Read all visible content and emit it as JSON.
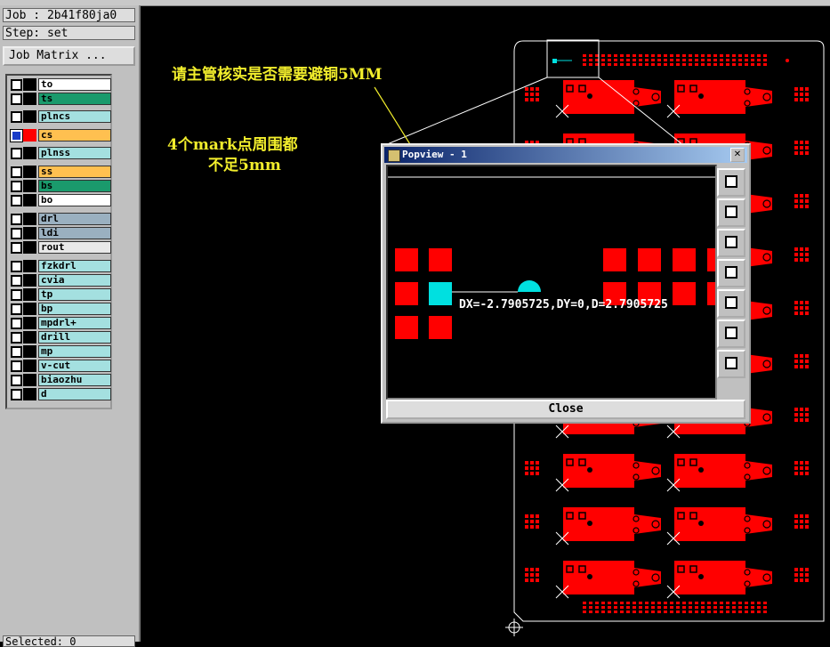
{
  "job": "Job : 2b41f80ja0",
  "step": "Step: set",
  "job_matrix": "Job Matrix ...",
  "layers": [
    {
      "name": "to",
      "color": "#ffffff",
      "swatch": "#000000",
      "checked": false
    },
    {
      "name": "ts",
      "color": "#1a9a6c",
      "swatch": "#000000",
      "checked": false
    },
    {
      "name": "plncs",
      "color": "#a4e0e0",
      "swatch": "#000000",
      "checked": false
    },
    {
      "name": "cs",
      "color": "#ffc050",
      "swatch": "#ff0000",
      "checked": true
    },
    {
      "name": "plnss",
      "color": "#a4e0e0",
      "swatch": "#000000",
      "checked": false
    },
    {
      "name": "ss",
      "color": "#ffc050",
      "swatch": "#000000",
      "checked": false
    },
    {
      "name": "bs",
      "color": "#1a9a6c",
      "swatch": "#000000",
      "checked": false
    },
    {
      "name": "bo",
      "color": "#ffffff",
      "swatch": "#000000",
      "checked": false
    },
    {
      "name": "drl",
      "color": "#9ab0c0",
      "swatch": "#000000",
      "checked": false
    },
    {
      "name": "ldi",
      "color": "#9ab0c0",
      "swatch": "#000000",
      "checked": false
    },
    {
      "name": "rout",
      "color": "#e8e8e8",
      "swatch": "#000000",
      "checked": false
    },
    {
      "name": "fzkdrl",
      "color": "#a4e0e0",
      "swatch": "#000000",
      "checked": false
    },
    {
      "name": "cvia",
      "color": "#a4e0e0",
      "swatch": "#000000",
      "checked": false
    },
    {
      "name": "tp",
      "color": "#a4e0e0",
      "swatch": "#000000",
      "checked": false
    },
    {
      "name": "bp",
      "color": "#a4e0e0",
      "swatch": "#000000",
      "checked": false
    },
    {
      "name": "mpdrl+",
      "color": "#a4e0e0",
      "swatch": "#000000",
      "checked": false
    },
    {
      "name": "drill",
      "color": "#a4e0e0",
      "swatch": "#000000",
      "checked": false
    },
    {
      "name": "mp",
      "color": "#a4e0e0",
      "swatch": "#000000",
      "checked": false
    },
    {
      "name": "v-cut",
      "color": "#a4e0e0",
      "swatch": "#000000",
      "checked": false
    },
    {
      "name": "biaozhu",
      "color": "#a4e0e0",
      "swatch": "#000000",
      "checked": false
    },
    {
      "name": "d",
      "color": "#a4e0e0",
      "swatch": "#000000",
      "checked": false
    }
  ],
  "bottom_text": "Selected: 0",
  "annotations": {
    "note1": "请主管核实是否需要避铜5MM",
    "note2_line1": "4个mark点周围都",
    "note2_line2": "不足5mm"
  },
  "popup": {
    "title": "Popview - 1",
    "close_label": "Close",
    "close_x": "✕",
    "measurement": "DX=-2.7905725,DY=0,D=2.7905725"
  },
  "colors": {
    "pad": "#ff0000",
    "board_outline": "#ffffff",
    "highlight": "#00e0e0",
    "annotation": "#f2ee2c"
  }
}
